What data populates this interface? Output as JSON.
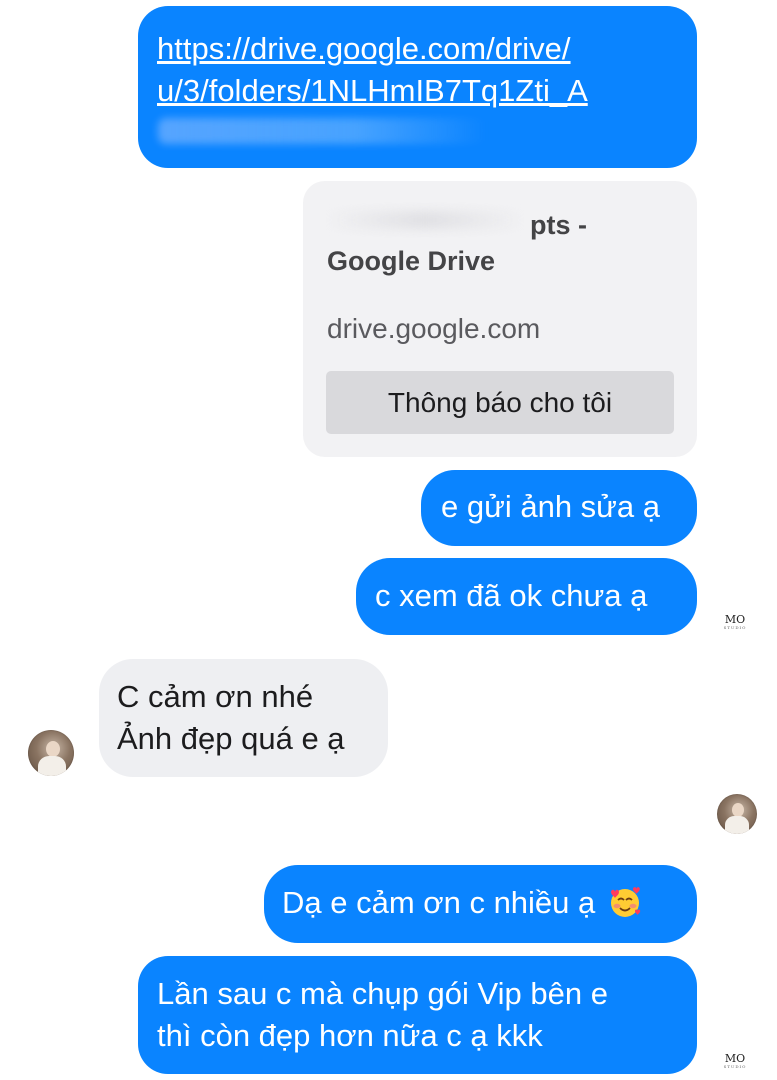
{
  "messages": {
    "m1_link_line1": "https://drive.google.com/drive/",
    "m1_link_line2": "u/3/folders/1NLHmIB7Tq1Zti_A",
    "card": {
      "title_line1": "pts -",
      "title_line2": "Google Drive",
      "domain": "drive.google.com",
      "button_label": "Thông báo cho tôi"
    },
    "m2": "e gửi ảnh sửa ạ",
    "m3": "c xem đã ok chưa ạ",
    "m4_line1": "C cảm ơn nhé",
    "m4_line2": "Ảnh đẹp quá e ạ",
    "m5": "Dạ e cảm ơn c nhiều ạ",
    "m6_line1": "Lần sau c mà chụp gói Vip bên e",
    "m6_line2": "thì còn đẹp hơn nữa c ạ kkk"
  },
  "watermark": "MO",
  "colors": {
    "outgoing_bubble": "#0a84ff",
    "incoming_bubble": "#eeeff2",
    "card_background": "#f2f2f4"
  },
  "icons": {
    "emoji": "smiling-face-with-hearts"
  }
}
